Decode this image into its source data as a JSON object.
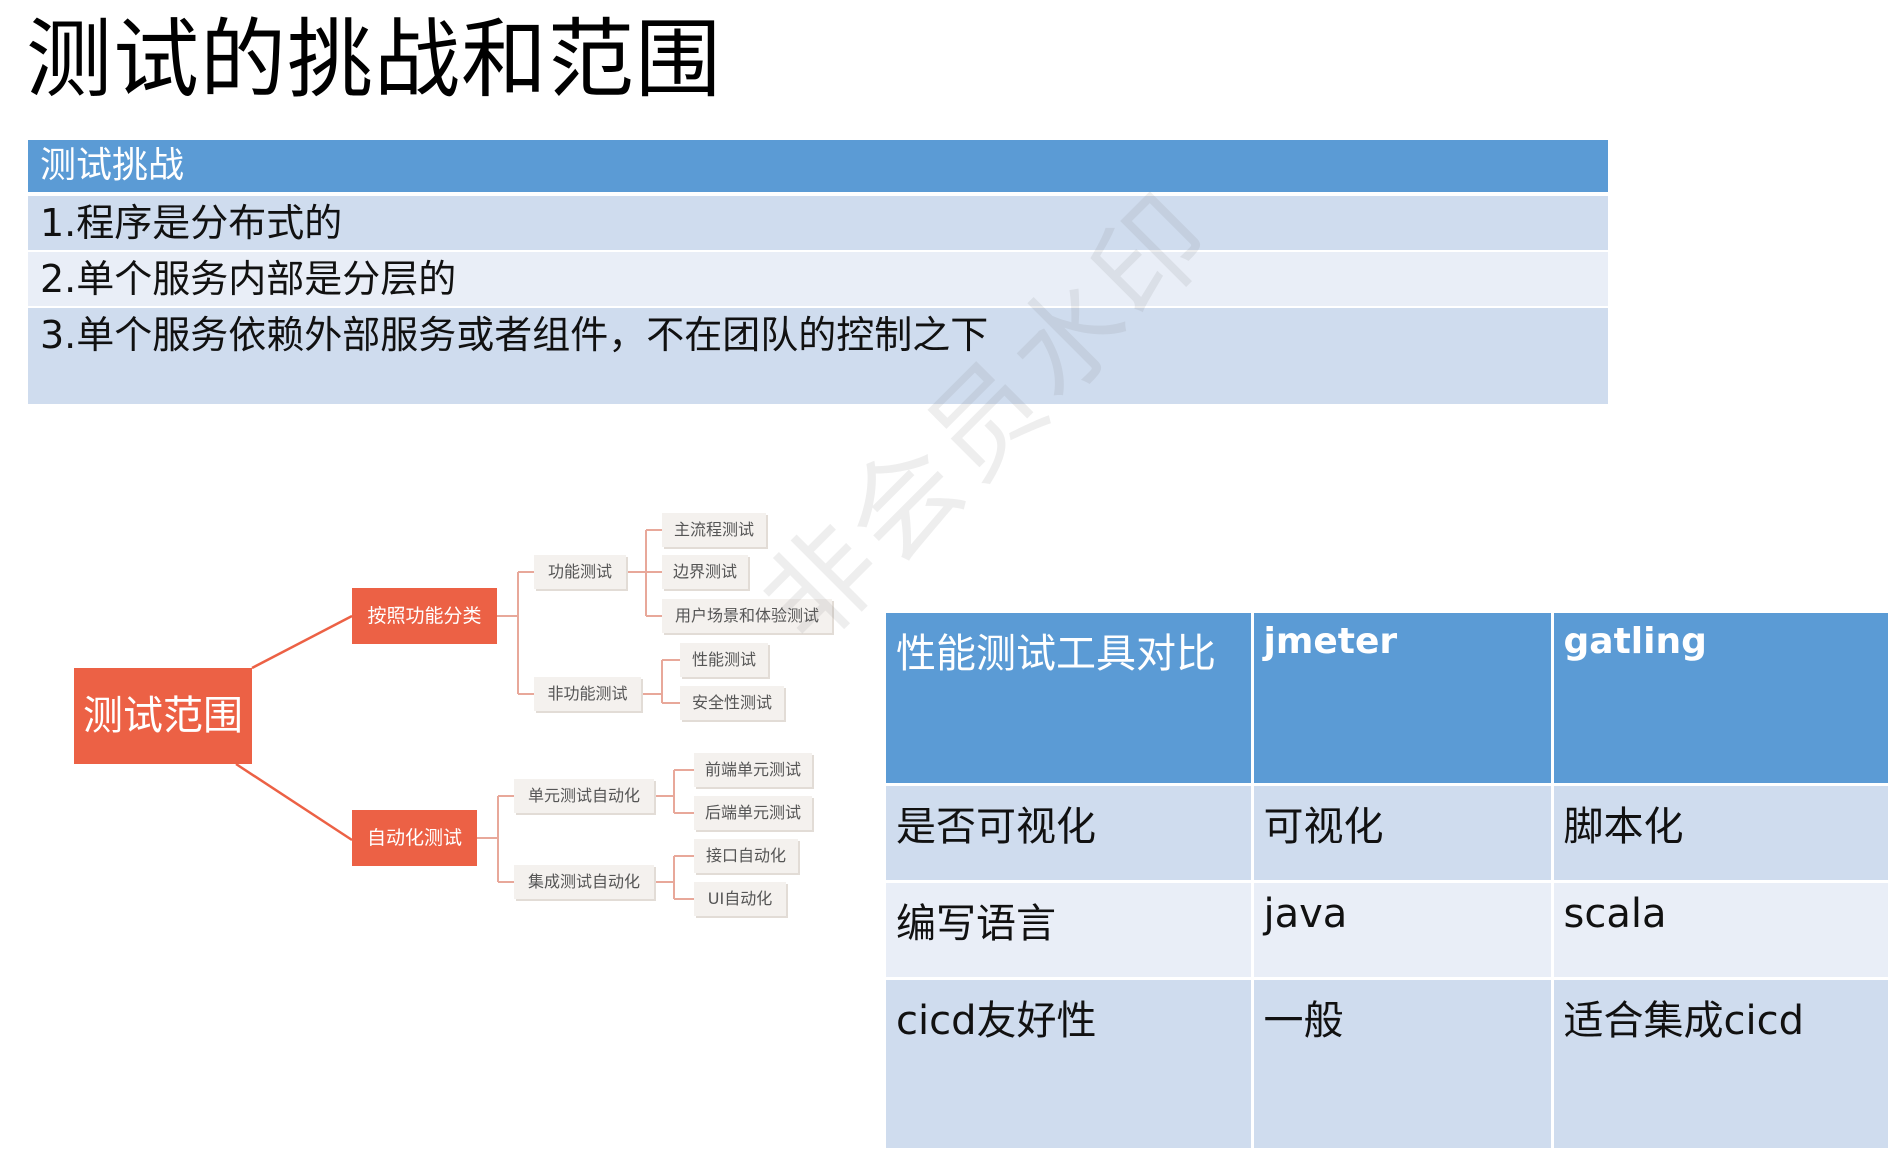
{
  "title": "测试的挑战和范围",
  "challenge_table": {
    "header": "测试挑战",
    "rows": [
      "1.程序是分布式的",
      "2.单个服务内部是分层的",
      "3.单个服务依赖外部服务或者组件，不在团队的控制之下"
    ]
  },
  "mindmap": {
    "root": "测试范围",
    "branch_function": "按照功能分类",
    "branch_automation": "自动化测试",
    "functional": "功能测试",
    "non_functional": "非功能测试",
    "main_flow": "主流程测试",
    "boundary": "边界测试",
    "user_scenario": "用户场景和体验测试",
    "performance": "性能测试",
    "security": "安全性测试",
    "unit_auto": "单元测试自动化",
    "integration_auto": "集成测试自动化",
    "frontend_unit": "前端单元测试",
    "backend_unit": "后端单元测试",
    "api_auto": "接口自动化",
    "ui_auto": "UI自动化"
  },
  "watermark": "非会员水印",
  "perf_table": {
    "headers": [
      "性能测试工具对比",
      "jmeter",
      "gatling"
    ],
    "rows": [
      [
        "是否可视化",
        "可视化",
        "脚本化"
      ],
      [
        "编写语言",
        "java",
        "scala"
      ],
      [
        "cicd友好性",
        "一般",
        "适合集成cicd"
      ]
    ]
  },
  "colors": {
    "header_blue": "#5b9bd5",
    "row_dark": "#cfdcee",
    "row_light": "#e9eef7",
    "mindmap_orange": "#ec6145"
  }
}
